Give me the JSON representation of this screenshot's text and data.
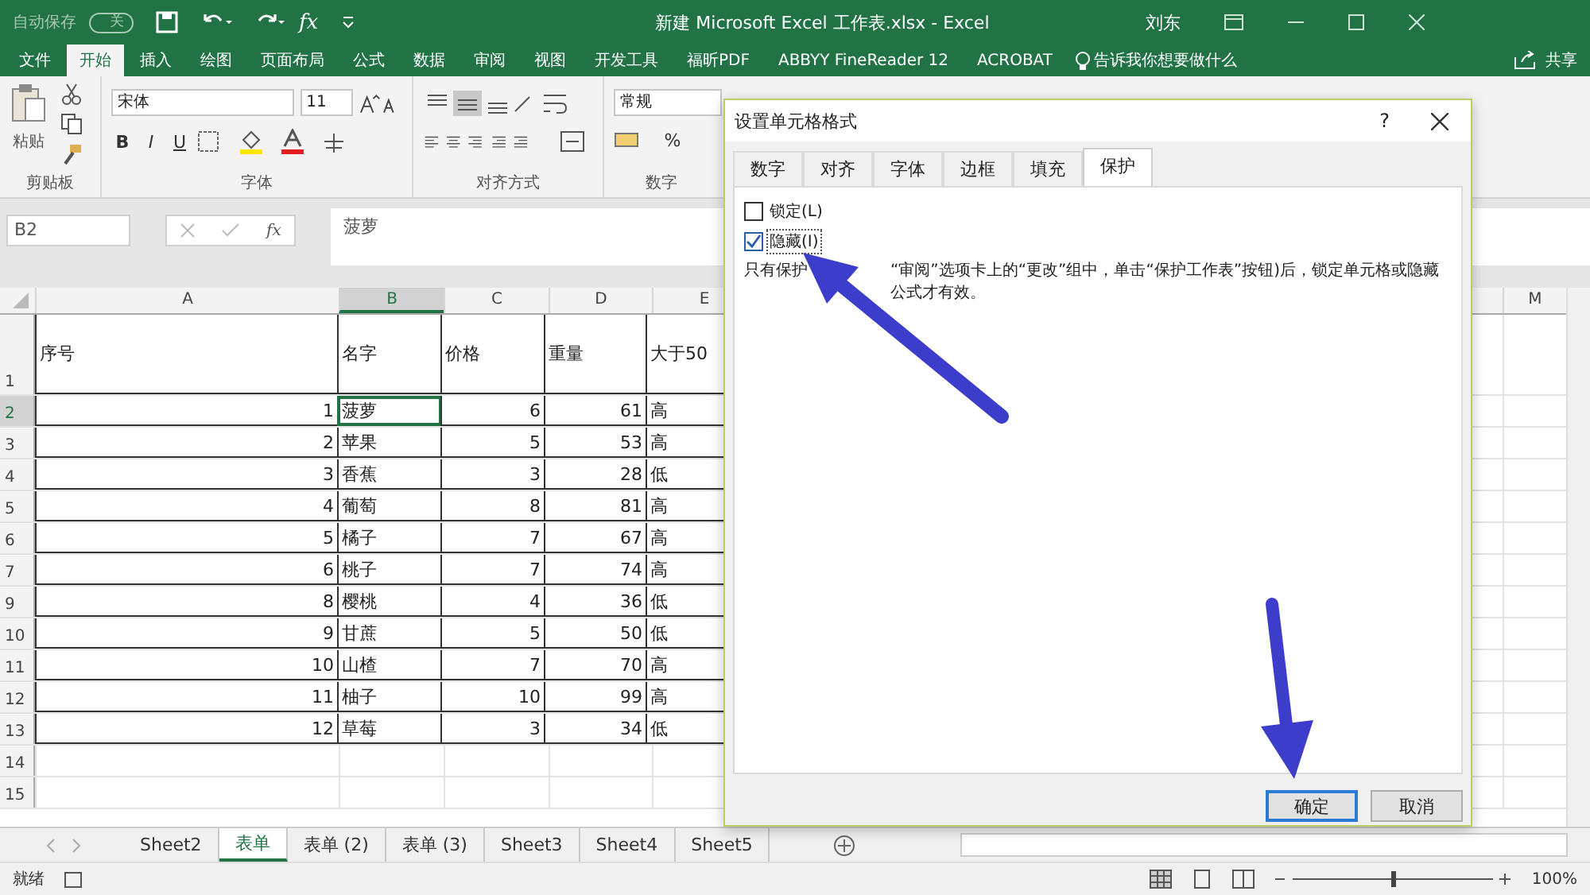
{
  "title_bar": {
    "autosave_label": "自动保存",
    "autosave_toggle": {
      "label": "关",
      "on": false
    },
    "fx": "fx",
    "title": "新建 Microsoft Excel 工作表.xlsx  -  Excel",
    "user": "刘东"
  },
  "ribbon_tabs": [
    {
      "label": "文件",
      "selected": false
    },
    {
      "label": "开始",
      "selected": true
    },
    {
      "label": "插入",
      "selected": false
    },
    {
      "label": "绘图",
      "selected": false
    },
    {
      "label": "页面布局",
      "selected": false
    },
    {
      "label": "公式",
      "selected": false
    },
    {
      "label": "数据",
      "selected": false
    },
    {
      "label": "审阅",
      "selected": false
    },
    {
      "label": "视图",
      "selected": false
    },
    {
      "label": "开发工具",
      "selected": false
    },
    {
      "label": "福昕PDF",
      "selected": false
    },
    {
      "label": "ABBYY FineReader 12",
      "selected": false
    },
    {
      "label": "ACROBAT",
      "selected": false
    }
  ],
  "tell_me": "告诉我你想要做什么",
  "share": "共享",
  "ribbon": {
    "paste": "粘贴",
    "font_name": "宋体",
    "font_size": "11",
    "bold": "B",
    "italic": "I",
    "underline": "U",
    "number_format": "常规",
    "percent": "%",
    "groups": [
      "剪贴板",
      "字体",
      "对齐方式",
      "数字"
    ]
  },
  "formula_bar": {
    "name_box": "B2",
    "fx": "fx",
    "content": "菠萝"
  },
  "sheet": {
    "columns": [
      {
        "label": "A",
        "selected": false
      },
      {
        "label": "B",
        "selected": true
      },
      {
        "label": "C",
        "selected": false
      },
      {
        "label": "D",
        "selected": false
      },
      {
        "label": "E",
        "selected": false
      },
      {
        "label": "M",
        "selected": false
      }
    ],
    "rows": [
      {
        "number": "1",
        "selected": false,
        "cells": [
          "序号",
          "名字",
          "价格",
          "重量",
          "大于50"
        ]
      },
      {
        "number": "2",
        "selected": true,
        "cells": [
          "1",
          "菠萝",
          "6",
          "61",
          "高"
        ]
      },
      {
        "number": "3",
        "selected": false,
        "cells": [
          "2",
          "苹果",
          "5",
          "53",
          "高"
        ]
      },
      {
        "number": "4",
        "selected": false,
        "cells": [
          "3",
          "香蕉",
          "3",
          "28",
          "低"
        ]
      },
      {
        "number": "5",
        "selected": false,
        "cells": [
          "4",
          "葡萄",
          "8",
          "81",
          "高"
        ]
      },
      {
        "number": "6",
        "selected": false,
        "cells": [
          "5",
          "橘子",
          "7",
          "67",
          "高"
        ]
      },
      {
        "number": "7",
        "selected": false,
        "cells": [
          "6",
          "桃子",
          "7",
          "74",
          "高"
        ]
      },
      {
        "number": "9",
        "selected": false,
        "cells": [
          "8",
          "樱桃",
          "4",
          "36",
          "低"
        ]
      },
      {
        "number": "10",
        "selected": false,
        "cells": [
          "9",
          "甘蔗",
          "5",
          "50",
          "低"
        ]
      },
      {
        "number": "11",
        "selected": false,
        "cells": [
          "10",
          "山楂",
          "7",
          "70",
          "高"
        ]
      },
      {
        "number": "12",
        "selected": false,
        "cells": [
          "11",
          "柚子",
          "10",
          "99",
          "高"
        ]
      },
      {
        "number": "13",
        "selected": false,
        "cells": [
          "12",
          "草莓",
          "3",
          "34",
          "低"
        ]
      },
      {
        "number": "14",
        "selected": false,
        "cells": []
      },
      {
        "number": "15",
        "selected": false,
        "cells": []
      }
    ]
  },
  "sheet_tabs": [
    {
      "label": "Sheet2",
      "selected": false
    },
    {
      "label": "表单",
      "selected": true
    },
    {
      "label": "表单 (2)",
      "selected": false
    },
    {
      "label": "表单 (3)",
      "selected": false
    },
    {
      "label": "Sheet3",
      "selected": false
    },
    {
      "label": "Sheet4",
      "selected": false
    },
    {
      "label": "Sheet5",
      "selected": false
    }
  ],
  "status_bar": {
    "status": "就绪",
    "zoom_slider": {
      "level": 0.5
    },
    "zoom": "100%"
  },
  "dialog": {
    "title": "设置单元格格式",
    "help": "?",
    "tabs": [
      {
        "label": "数字",
        "selected": false
      },
      {
        "label": "对齐",
        "selected": false
      },
      {
        "label": "字体",
        "selected": false
      },
      {
        "label": "边框",
        "selected": false
      },
      {
        "label": "填充",
        "selected": false
      },
      {
        "label": "保护",
        "selected": true
      }
    ],
    "options": [
      {
        "label": "锁定(L)",
        "checked": false
      },
      {
        "label": "隐藏(I)",
        "checked": true
      }
    ],
    "note_parts": [
      "只有保护",
      "“审阅”选项卡上的“更改”组中，单击“保护工作表”按钮)后，锁定单元格或隐藏公式才有效。"
    ],
    "buttons": [
      {
        "label": "确定",
        "default": true
      },
      {
        "label": "取消",
        "default": false
      }
    ]
  }
}
